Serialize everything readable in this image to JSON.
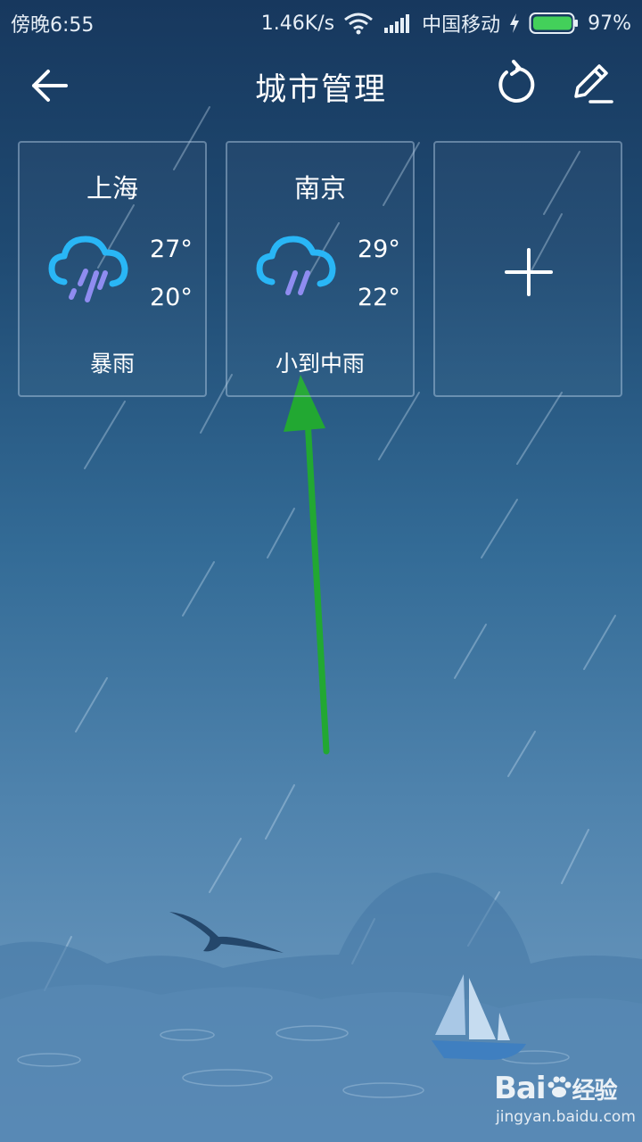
{
  "status_bar": {
    "time": "傍晚6:55",
    "network_speed": "1.46K/s",
    "carrier": "中国移动",
    "battery": "97%",
    "icons": [
      "wifi-icon",
      "signal-icon",
      "charging-icon",
      "battery-icon"
    ]
  },
  "header": {
    "title": "城市管理",
    "icons": [
      "back-arrow-icon",
      "refresh-icon",
      "edit-icon"
    ]
  },
  "cities": [
    {
      "name": "上海",
      "high": "27°",
      "low": "20°",
      "condition": "暴雨",
      "icon": "heavy-rain-icon"
    },
    {
      "name": "南京",
      "high": "29°",
      "low": "22°",
      "condition": "小到中雨",
      "icon": "rain-icon"
    }
  ],
  "add_card": {
    "icon": "plus-icon"
  },
  "watermark": {
    "brand": "Bai",
    "brand_suffix": "经验",
    "site": "jingyan.baidu.com"
  },
  "colors": {
    "cloud": "#29b6f6",
    "rain": "#8f8cf0",
    "annotation_arrow": "#22a832",
    "sail": "#a9c8e6",
    "hull": "#3f7fc0"
  }
}
